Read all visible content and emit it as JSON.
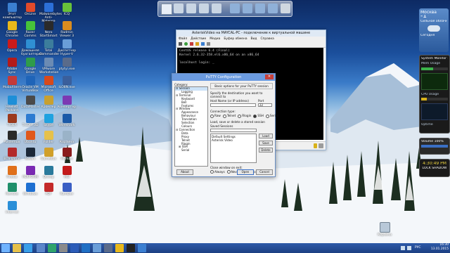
{
  "desktop": {
    "icons": [
      {
        "label": "Этот компьютер",
        "icon": "computer-icon",
        "color": "#3b7fd1"
      },
      {
        "label": "OnLine",
        "icon": "online-icon",
        "color": "#e04a2b"
      },
      {
        "label": "Malwarebytes Anti-Malware",
        "icon": "malwarebytes-icon",
        "color": "#2c6fd8"
      },
      {
        "label": "ICQ",
        "icon": "icq-icon",
        "color": "#68c23a"
      },
      {
        "label": "Google Chrome",
        "icon": "chrome-icon",
        "color": "#e8b81b"
      },
      {
        "label": "Razer Comms",
        "icon": "razer-icon",
        "color": "#47c43a"
      },
      {
        "label": "Nero StartSmart",
        "icon": "nero-icon",
        "color": "#2a2a2a"
      },
      {
        "label": "Radmin Viewer 3",
        "icon": "radmin-icon",
        "color": "#d98c1f"
      },
      {
        "label": "Opera",
        "icon": "opera-icon",
        "color": "#cc1b1b"
      },
      {
        "label": "Домашняя бухгалтерия",
        "icon": "accounting-icon",
        "color": "#2f8fd3"
      },
      {
        "label": "Total Commander",
        "icon": "total-commander-icon",
        "color": "#3c7d9c"
      },
      {
        "label": "Диспетчер Hyper-V",
        "icon": "hyperv-icon",
        "color": "#6a9ed8"
      },
      {
        "label": "Adobe Sync",
        "icon": "adobe-icon",
        "color": "#b31b1b"
      },
      {
        "label": "Google Drive",
        "icon": "gdrive-icon",
        "color": "#2f9c4a"
      },
      {
        "label": "VMware Workstation",
        "icon": "vmware-icon",
        "color": "#6b8bb3"
      },
      {
        "label": "ptytyi.exe",
        "icon": "putty-icon",
        "color": "#5a6b8a"
      },
      {
        "label": "MobaXterm",
        "icon": "mobaxterm-icon",
        "color": "#c43a3a"
      },
      {
        "label": "Oracle VM VirtualBox",
        "icon": "virtualbox-icon",
        "color": "#1f64b8"
      },
      {
        "label": "Microsoft Office",
        "icon": "office-icon",
        "color": "#d84a1b"
      },
      {
        "label": "ILO8N.exe",
        "icon": "app-icon",
        "color": "#3a5f9c"
      },
      {
        "label": "Hewlett Packard",
        "icon": "hp-icon",
        "color": "#1d8fd8"
      },
      {
        "label": "DataMaster",
        "icon": "datamaster-icon",
        "color": "#4a4a4a"
      },
      {
        "label": "Кромлер",
        "icon": "app-icon",
        "color": "#c8a030"
      },
      {
        "label": "Конвертер",
        "icon": "converter-icon",
        "color": "#7c3ab3"
      },
      {
        "label": "TIGER",
        "icon": "app-icon",
        "color": "#9c3a1d"
      },
      {
        "label": "TruDef 3D",
        "icon": "app-icon",
        "color": "#2c7bd1"
      },
      {
        "label": "Skype",
        "icon": "skype-icon",
        "color": "#1fa2e0"
      },
      {
        "label": "Wireshark",
        "icon": "wireshark-icon",
        "color": "#1b5aa8"
      },
      {
        "label": "Avidemux",
        "icon": "app-icon",
        "color": "#2a2a2a"
      },
      {
        "label": "Ubuntu",
        "icon": "ubuntu-icon",
        "color": "#e0581b"
      },
      {
        "label": "Folder",
        "icon": "folder-icon",
        "color": "#e6c14a"
      },
      {
        "label": "Корзина",
        "icon": "recycle-bin-icon",
        "color": "#9ab3c8"
      },
      {
        "label": "BTS game",
        "icon": "game-icon",
        "color": "#b32a2a"
      },
      {
        "label": "Steam",
        "icon": "steam-icon",
        "color": "#1b2838"
      },
      {
        "label": "GameBox",
        "icon": "app-icon",
        "color": "#d1a02a"
      },
      {
        "label": "Hitman",
        "icon": "game-icon",
        "color": "#8a1b1b"
      },
      {
        "label": "Firefox",
        "icon": "firefox-icon",
        "color": "#e0701b"
      },
      {
        "label": "PERFORM",
        "icon": "app-icon",
        "color": "#7a2ab3"
      },
      {
        "label": "Qmmp",
        "icon": "app-icon",
        "color": "#2a7a9c"
      },
      {
        "label": "MSI",
        "icon": "app-icon",
        "color": "#c41b1b"
      },
      {
        "label": "Remote",
        "icon": "app-icon",
        "color": "#1f8f6a"
      },
      {
        "label": "Windows",
        "icon": "app-icon",
        "color": "#1d6fd1"
      },
      {
        "label": "PDF",
        "icon": "pdf-icon",
        "color": "#c42a2a"
      },
      {
        "label": "Rambler",
        "icon": "app-icon",
        "color": "#3a5fc4"
      },
      {
        "label": "Internet",
        "icon": "ie-icon",
        "color": "#2a8fd8"
      }
    ],
    "bottom_right_icon": {
      "label": "Корзина",
      "icon": "recycle-bin-icon"
    }
  },
  "gadgets": {
    "weather": {
      "city": "Москва",
      "temp": "-1°",
      "line2": "Сильная облачность",
      "day": "Сегодня"
    },
    "sysmon": {
      "title": "System Monitor II",
      "line1": "Mem Usage",
      "line2": "CPU Usage",
      "line3": "Uptime"
    },
    "volume": {
      "label": "Volume",
      "value": "100%"
    },
    "clock": {
      "time": "4:30:49 PM",
      "label": "LOCK SHADOW"
    }
  },
  "vm_window": {
    "title": "AsteriskVideo на MAYCAL-PC - подключение к виртуальной машине",
    "menu": [
      "Файл",
      "Действие",
      "Медиа",
      "Буфер обмена",
      "Вид",
      "Справка"
    ],
    "console_lines": [
      "CentOS release 6.4 (Final)",
      "Kernel 2.6.32-358.el6.x86_64 on an x86_64",
      "",
      "localhost login: _"
    ],
    "status": "Состояние: Работает"
  },
  "putty": {
    "title": "PuTTY Configuration",
    "category_label": "Category:",
    "tree": [
      {
        "label": "Session",
        "level": 0,
        "icon": "minus"
      },
      {
        "label": "Logging",
        "level": 2
      },
      {
        "label": "Terminal",
        "level": 0,
        "icon": "minus"
      },
      {
        "label": "Keyboard",
        "level": 2
      },
      {
        "label": "Bell",
        "level": 2
      },
      {
        "label": "Features",
        "level": 2
      },
      {
        "label": "Window",
        "level": 0,
        "icon": "minus"
      },
      {
        "label": "Appearance",
        "level": 2
      },
      {
        "label": "Behaviour",
        "level": 2
      },
      {
        "label": "Translation",
        "level": 2
      },
      {
        "label": "Selection",
        "level": 2
      },
      {
        "label": "Colours",
        "level": 2
      },
      {
        "label": "Connection",
        "level": 0,
        "icon": "minus"
      },
      {
        "label": "Data",
        "level": 2
      },
      {
        "label": "Proxy",
        "level": 2
      },
      {
        "label": "Telnet",
        "level": 2
      },
      {
        "label": "Rlogin",
        "level": 2
      },
      {
        "label": "SSH",
        "level": 1,
        "icon": "plus"
      },
      {
        "label": "Serial",
        "level": 2
      }
    ],
    "basic_options": "Basic options for your PuTTY session",
    "specify_dest": "Specify the destination you want to connect to",
    "host_label": "Host Name (or IP address)",
    "port_label": "Port",
    "host_value": "",
    "port_value": "22",
    "conn_type_label": "Connection type:",
    "conn_types": [
      {
        "label": "Raw",
        "selected": false
      },
      {
        "label": "Telnet",
        "selected": false
      },
      {
        "label": "Rlogin",
        "selected": false
      },
      {
        "label": "SSH",
        "selected": true
      },
      {
        "label": "Serial",
        "selected": false
      }
    ],
    "load_save_label": "Load, save or delete a stored session",
    "saved_sessions_label": "Saved Sessions",
    "saved_value": "",
    "sessions": [
      "Default Settings",
      "Asterisk Video"
    ],
    "load_btn": "Load",
    "save_btn": "Save",
    "delete_btn": "Delete",
    "close_exit_label": "Close window on exit:",
    "close_options": [
      {
        "label": "Always",
        "selected": false
      },
      {
        "label": "Never",
        "selected": false
      },
      {
        "label": "Only on clean exit",
        "selected": true
      }
    ],
    "about_btn": "About",
    "open_btn": "Open",
    "cancel_btn": "Cancel"
  },
  "taskbar": {
    "apps": [
      {
        "name": "start-button",
        "icon": "windows-icon",
        "color": "#6fb3ff"
      },
      {
        "name": "taskbar-explorer",
        "icon": "folder-icon",
        "color": "#e6c14a"
      },
      {
        "name": "taskbar-ie",
        "icon": "ie-icon",
        "color": "#3a9fe8"
      },
      {
        "name": "taskbar-app1",
        "icon": "app-icon",
        "color": "#5b86c9"
      },
      {
        "name": "taskbar-store",
        "icon": "store-icon",
        "color": "#2fa36b"
      },
      {
        "name": "taskbar-calc",
        "icon": "calculator-icon",
        "color": "#8a8a8a"
      },
      {
        "name": "taskbar-word",
        "icon": "word-icon",
        "color": "#2b5cb8"
      },
      {
        "name": "taskbar-outlook",
        "icon": "outlook-icon",
        "color": "#1f6fc4"
      },
      {
        "name": "taskbar-hyperv",
        "icon": "hyperv-icon",
        "color": "#6a9ed8"
      },
      {
        "name": "taskbar-putty",
        "icon": "putty-icon",
        "color": "#5a6b8a"
      },
      {
        "name": "taskbar-chrome",
        "icon": "chrome-icon",
        "color": "#e8b81b"
      },
      {
        "name": "taskbar-cmd",
        "icon": "terminal-icon",
        "color": "#222"
      },
      {
        "name": "taskbar-vm",
        "icon": "vm-icon",
        "color": "#3b7fd1"
      }
    ],
    "lang": "РУС",
    "time": "16:30",
    "date": "13.01.2015"
  },
  "colors": {
    "taskbar": "#1c3f82",
    "putty_title": "#6b9be0",
    "console": "#000000"
  }
}
